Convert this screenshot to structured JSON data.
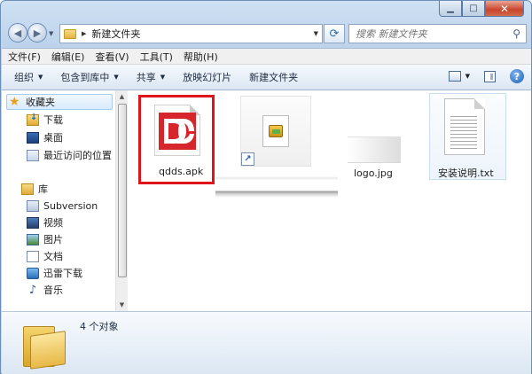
{
  "window": {
    "caption_buttons": {
      "minimize": "▁",
      "maximize": "□",
      "close": "✕"
    }
  },
  "address": {
    "path": "新建文件夹",
    "search_placeholder": "搜索 新建文件夹"
  },
  "menu": [
    "文件(F)",
    "编辑(E)",
    "查看(V)",
    "工具(T)",
    "帮助(H)"
  ],
  "toolbar": {
    "organize": "组织",
    "include_library": "包含到库中",
    "share": "共享",
    "slideshow": "放映幻灯片",
    "new_folder": "新建文件夹"
  },
  "nav": {
    "favorites": "收藏夹",
    "downloads": "下载",
    "desktop": "桌面",
    "recent": "最近访问的位置",
    "libraries": "库",
    "subversion": "Subversion",
    "videos": "视频",
    "pictures": "图片",
    "documents": "文档",
    "xunlei": "迅雷下载",
    "music": "音乐"
  },
  "files": [
    {
      "name": "qdds.apk",
      "icon": "apk-logo-icon",
      "selected": true
    },
    {
      "name": "",
      "icon": "shortcut-icon"
    },
    {
      "name": "logo.jpg",
      "icon": "image-thumbnail"
    },
    {
      "name": "安装说明.txt",
      "icon": "text-file-icon"
    }
  ],
  "status": {
    "count": "4 个对象"
  },
  "colors": {
    "selection_outline": "#e0141b",
    "apk_brand": "#d6262b"
  }
}
